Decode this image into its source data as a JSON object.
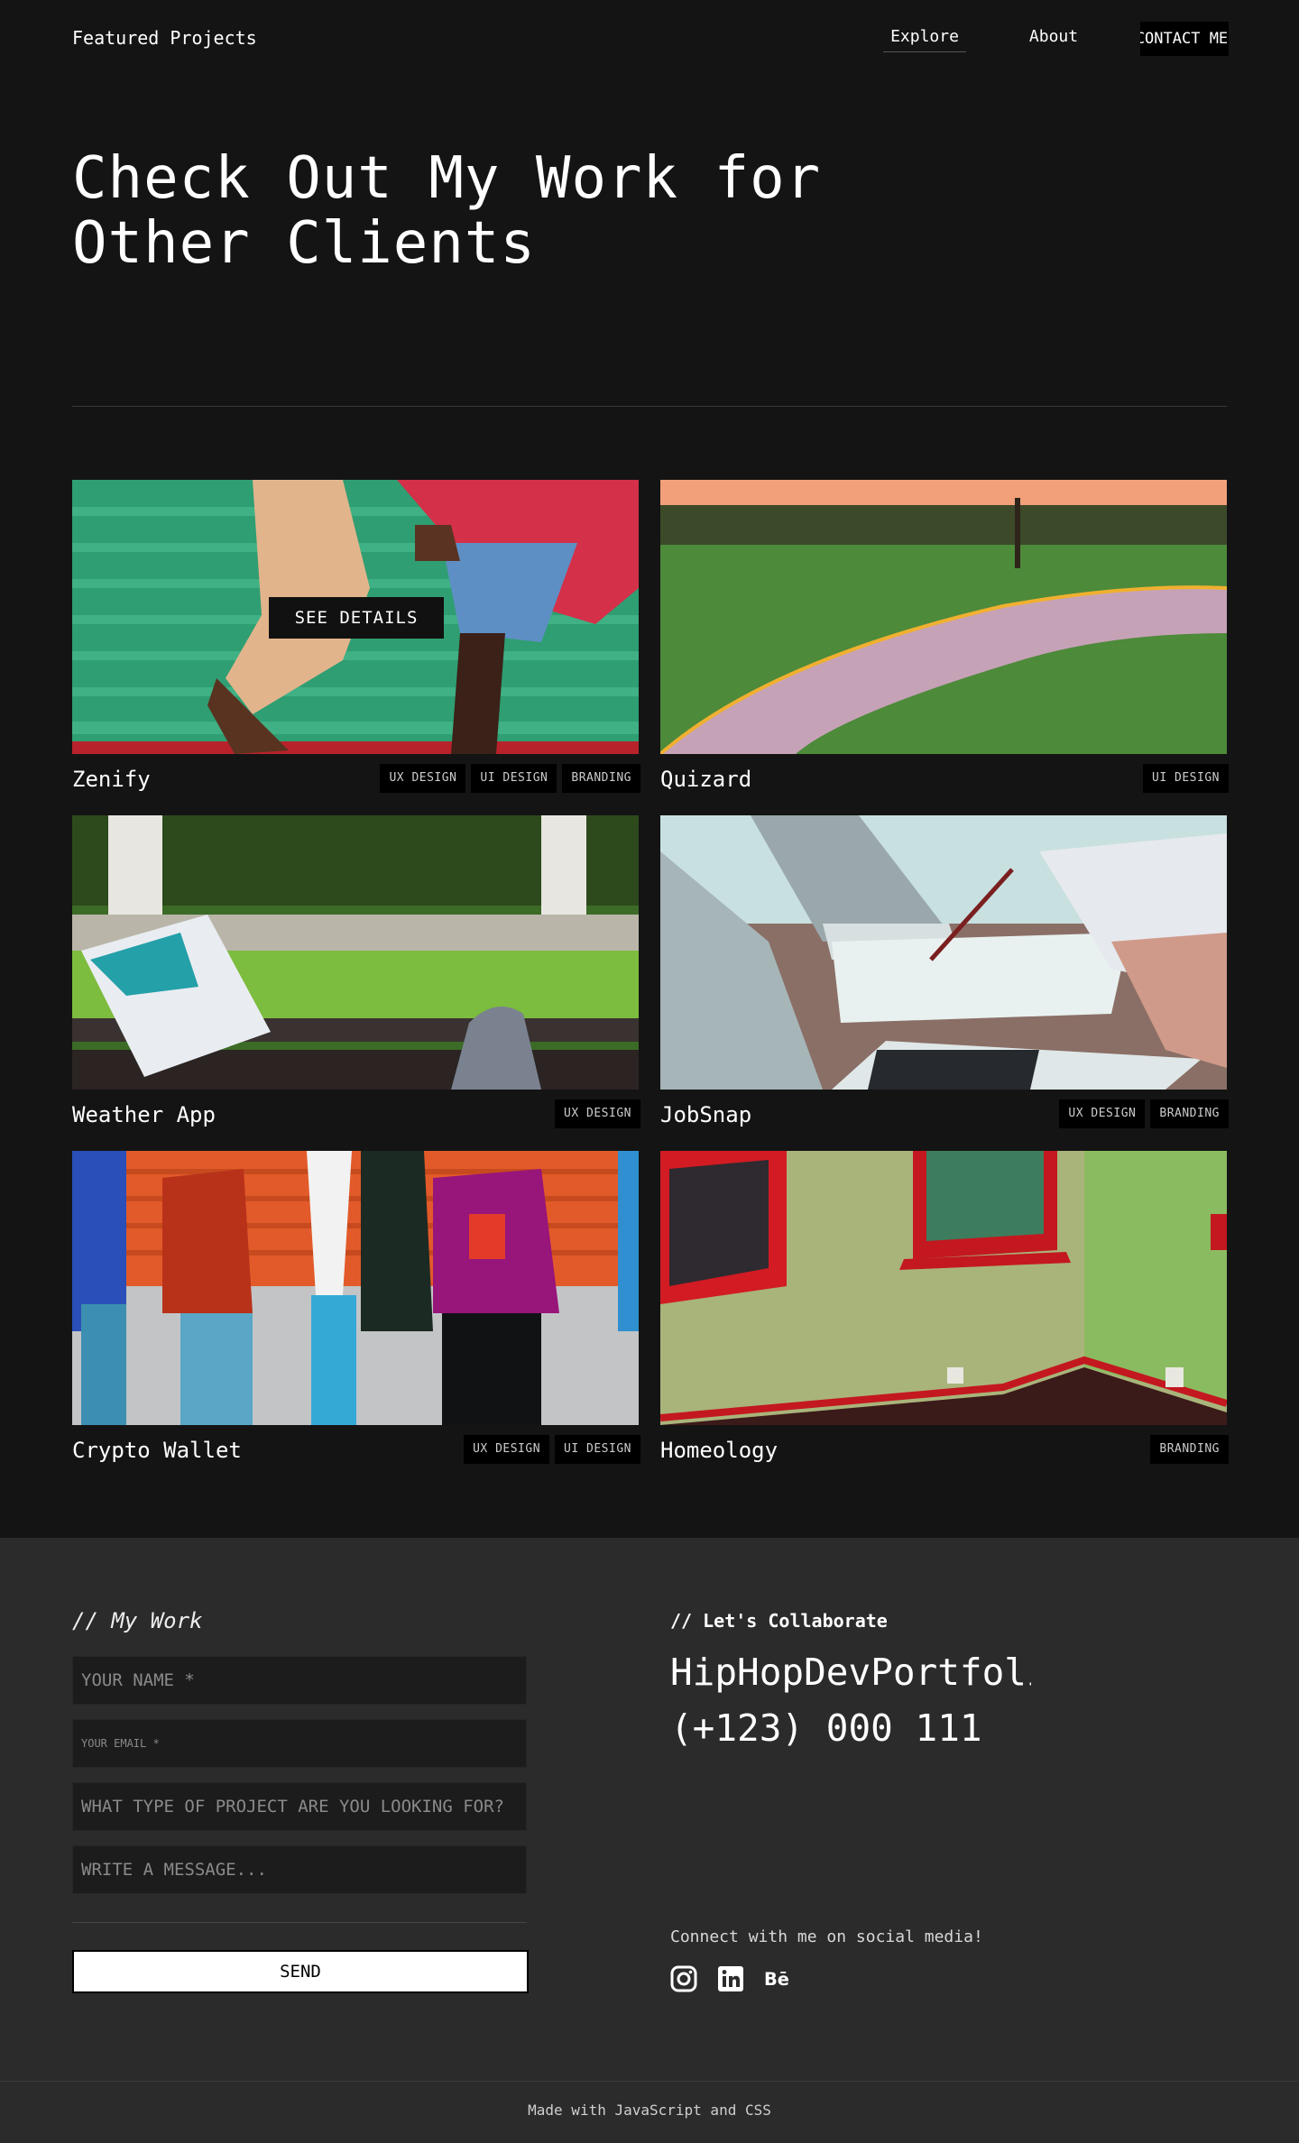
{
  "header": {
    "brand": "Featured Projects",
    "nav": {
      "explore": "Explore",
      "about": "About",
      "contact": "CONTACT ME"
    }
  },
  "hero": {
    "line1": "Check Out My Work for",
    "line2": "Other Clients"
  },
  "projects": [
    {
      "title": "Zenify",
      "tags": [
        "UX DESIGN",
        "UI DESIGN",
        "BRANDING"
      ],
      "hover_label": "SEE DETAILS",
      "image": "green-bench-person-photo"
    },
    {
      "title": "Quizard",
      "tags": [
        "UI DESIGN"
      ],
      "image": "park-path-sunset-photo"
    },
    {
      "title": "Weather App",
      "tags": [
        "UX DESIGN"
      ],
      "image": "book-on-bench-photo"
    },
    {
      "title": "JobSnap",
      "tags": [
        "UX DESIGN",
        "BRANDING"
      ],
      "image": "laptop-desk-notes-photo"
    },
    {
      "title": "Crypto Wallet",
      "tags": [
        "UX DESIGN",
        "UI DESIGN"
      ],
      "image": "group-of-people-photo"
    },
    {
      "title": "Homeology",
      "tags": [
        "BRANDING"
      ],
      "image": "green-room-red-window-photo"
    }
  ],
  "form": {
    "title": "// My Work",
    "name_placeholder": "YOUR NAME *",
    "email_placeholder": "YOUR EMAIL *",
    "project_placeholder": "WHAT TYPE OF PROJECT ARE YOU LOOKING FOR?",
    "message_placeholder": "WRITE A MESSAGE...",
    "send_label": "SEND"
  },
  "collab": {
    "title": "// Let's Collaborate",
    "name": "HipHopDevPortfolio",
    "phone": "(+123) 000 111",
    "social_text": "Connect with me on social media!",
    "icons": [
      "instagram-icon",
      "linkedin-icon",
      "behance-icon"
    ]
  },
  "footer": {
    "made_with": "Made with JavaScript and CSS"
  },
  "colors": {
    "background": "#141414",
    "footer": "#2b2b2b",
    "tag": "#000000",
    "button": "#ffffff"
  }
}
